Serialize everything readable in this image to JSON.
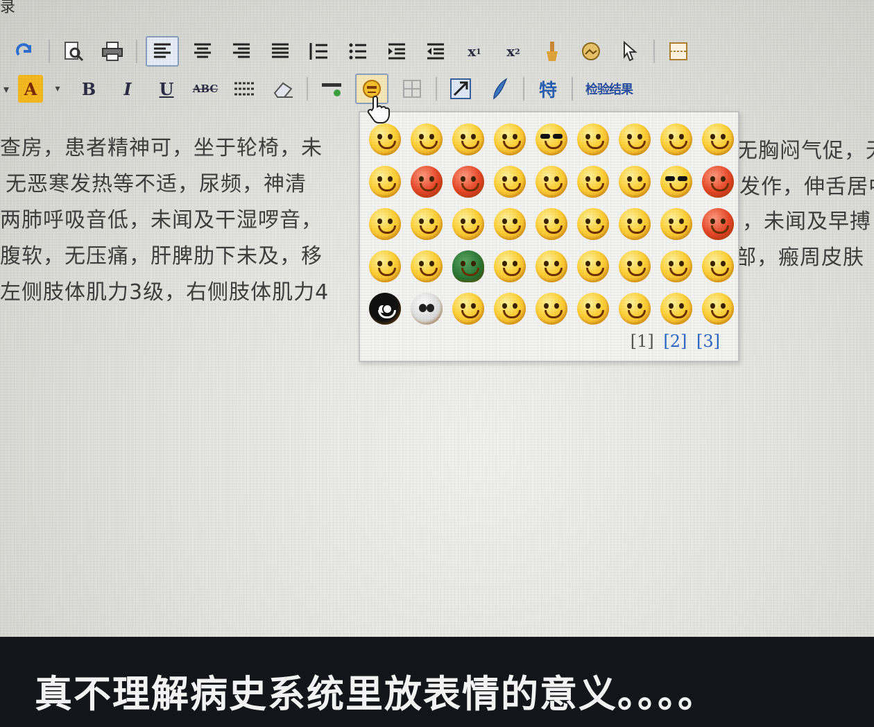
{
  "window": {
    "title_fragment": "录"
  },
  "toolbar": {
    "row1": [
      "redo-icon",
      "find-icon",
      "print-icon",
      "align-left-icon",
      "align-center-icon",
      "align-right-icon",
      "justify-icon",
      "ordered-list-icon",
      "unordered-list-icon",
      "outdent-icon",
      "indent-icon",
      "subscript-icon",
      "superscript-icon",
      "format-brush-icon",
      "image-icon",
      "cursor-icon",
      "page-break-icon"
    ],
    "row2": {
      "font_color": "A",
      "bold": "B",
      "italic": "I",
      "underline": "U",
      "strikethrough": "ABC",
      "special_char": "特",
      "template_label": "检验结果"
    }
  },
  "document": {
    "lines_left": [
      "查房，患者精神可，坐于轮椅，未",
      " 无恶寒发热等不适，尿频，神清",
      "两肺呼吸音低，未闻及干湿啰音，",
      "腹软，无压痛，肝脾肋下未及，移",
      "左侧肢体肌力3级，右侧肢体肌力4"
    ],
    "lines_right": [
      "无胸闷气促，无",
      "发作，伸舌居中",
      "，未闻及早搏",
      "部，瘢周皮肤"
    ]
  },
  "emoji_panel": {
    "rows": [
      [
        "smile",
        "grin",
        "heart-eyes",
        "dizzy",
        "sunglasses",
        "surprised",
        "angry",
        "shy",
        "sleepy"
      ],
      [
        "laugh",
        "red-angry",
        "furious",
        "kiss",
        "big-grin",
        "wink",
        "sad",
        "cool",
        "blush-red"
      ],
      [
        "cry",
        "happy",
        "giggle",
        "smirk",
        "proud",
        "blank",
        "shocked",
        "sweat",
        "red-shout"
      ],
      [
        "sneer",
        "tongue",
        "turtle",
        "bleeding",
        "pout",
        "confused",
        "wide-eyed",
        "hush",
        "sleep"
      ],
      [
        "black-ghost",
        "skull",
        "hammer",
        "frown",
        "cheer",
        "thinking",
        "daze",
        "whisper",
        "chuckle"
      ]
    ],
    "pages": [
      "[1]",
      "[2]",
      "[3]"
    ]
  },
  "caption": "真不理解病史系统里放表情的意义。。。。",
  "colors": {
    "caption_bg": "#14151b",
    "link": "#2b67c4",
    "face": "#ffd23a"
  }
}
